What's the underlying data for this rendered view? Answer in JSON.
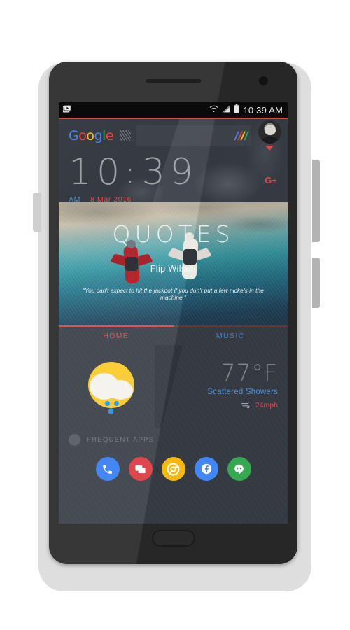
{
  "status_bar": {
    "left_icons": [
      "screenshot-icon"
    ],
    "right_icons": [
      "wifi-icon",
      "signal-icon",
      "battery-icon"
    ],
    "time": "10:39 AM"
  },
  "search": {
    "logo_letters": [
      "G",
      "o",
      "o",
      "g",
      "l",
      "e"
    ],
    "hatch_icon": "hatch-pattern-icon",
    "slash_colors": [
      "#4285F4",
      "#EA4335",
      "#FBBC05",
      "#34A853"
    ],
    "avatar_name": "user-avatar",
    "caret_icon": "caret-down-icon"
  },
  "clock": {
    "hour_tens": "1",
    "hour_ones": "0",
    "colon": ":",
    "minute_tens": "3",
    "minute_ones": "9",
    "ampm": "AM",
    "date": "8 Mar 2016",
    "gplus": "G+"
  },
  "quote_card": {
    "title": "QUOTES",
    "author": "Flip Wilson",
    "text": "\"You can't expect to hit the jackpot if you don't put a few nickels in the machine.\""
  },
  "tabs": [
    {
      "label": "HOME",
      "active": true,
      "color": "#e0474c"
    },
    {
      "label": "MUSIC",
      "active": false,
      "color": "#4a90d9"
    }
  ],
  "weather": {
    "icon": "sun-behind-rain-cloud-icon",
    "temperature": "77°F",
    "condition": "Scattered Showers",
    "wind_icon": "wind-icon",
    "wind": "24mph"
  },
  "frequent_apps": {
    "star_icon": "star-icon",
    "label": "FREQUENT APPS",
    "apps": [
      {
        "name": "phone-app",
        "icon": "phone-icon",
        "color": "#4287f5"
      },
      {
        "name": "messages-app",
        "icon": "message-icon",
        "color": "#e0474c"
      },
      {
        "name": "chrome-app",
        "icon": "chrome-icon",
        "color": "#F5B812"
      },
      {
        "name": "facebook-app",
        "icon": "facebook-icon",
        "color": "#4287f5"
      },
      {
        "name": "hangouts-app",
        "icon": "hangouts-icon",
        "color": "#36A852"
      }
    ]
  },
  "colors": {
    "accent_red": "#e0474c",
    "accent_blue": "#4a90d9",
    "bg_dark": "#3b4149"
  }
}
